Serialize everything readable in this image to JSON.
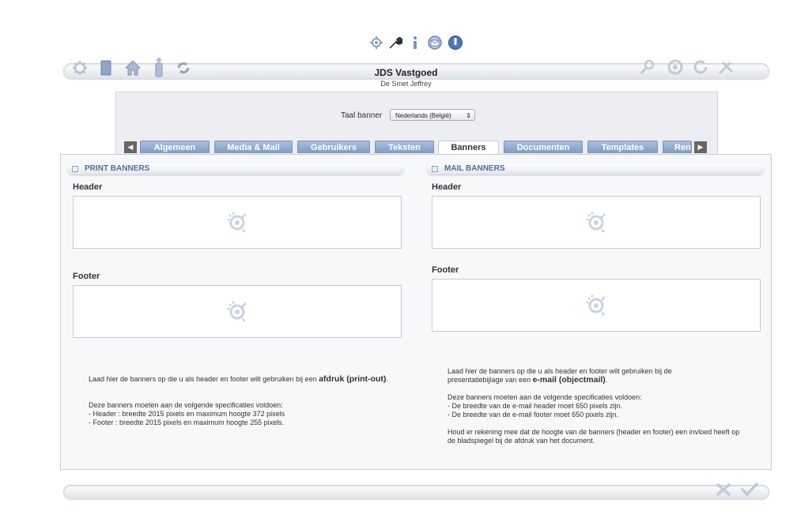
{
  "header": {
    "title": "JDS Vastgoed",
    "subtitle": "De Smet Jeffrey",
    "top_icons": [
      "gear-hand-icon",
      "wrench-icon",
      "info-icon",
      "mail-icon",
      "power-icon"
    ],
    "left_icons": [
      "gear-icon",
      "document-icon",
      "home-icon",
      "person-icon",
      "sync-icon"
    ],
    "right_icons": [
      "search-icon",
      "link-icon",
      "refresh-icon",
      "tools-icon"
    ]
  },
  "language": {
    "label": "Taal banner",
    "selected": "Nederlands (België)"
  },
  "tabs": [
    {
      "label": "Algemeen"
    },
    {
      "label": "Media & Mail"
    },
    {
      "label": "Gebruikers"
    },
    {
      "label": "Teksten"
    },
    {
      "label": "Banners"
    },
    {
      "label": "Documenten"
    },
    {
      "label": "Templates"
    },
    {
      "label": "Ren"
    }
  ],
  "print": {
    "section_title": "PRINT BANNERS",
    "header_label": "Header",
    "footer_label": "Footer",
    "info_line1": "Laad hier de banners op die u als header en footer wilt gebruiken bij een",
    "info_bold": "afdruk (print-out)",
    "info_end": ".",
    "spec_intro": "Deze banners moeten aan de volgende specificaties voldoen:",
    "spec_header": "- Header : breedte 2015 pixels en maximum hoogte 372 pixels",
    "spec_footer": "- Footer : breedte 2015 pixels en maximum hoogte 255 pixels."
  },
  "mail": {
    "section_title": "MAIL BANNERS",
    "header_label": "Header",
    "footer_label": "Footer",
    "info_line1": "Laad hier de banners op die u als header en footer wilt gebruiken bij de presentatiebijlage van een",
    "info_bold": "e-mail (objectmail)",
    "info_end": ".",
    "spec_intro": "Deze banners moeten aan de volgende specificaties voldoen:",
    "spec_header": "- De breedte van de e-mail header moet 650 pixels zijn.",
    "spec_footer": "- De breedte van de e-mail footer moet 650 pixels zijn.",
    "note": "Houd er rekening mee dat de hoogte van de banners (header en footer) een invloed heeft op de bladspiegel bij de afdruk van het document."
  },
  "footer_icons": [
    "cancel-icon",
    "confirm-icon"
  ]
}
